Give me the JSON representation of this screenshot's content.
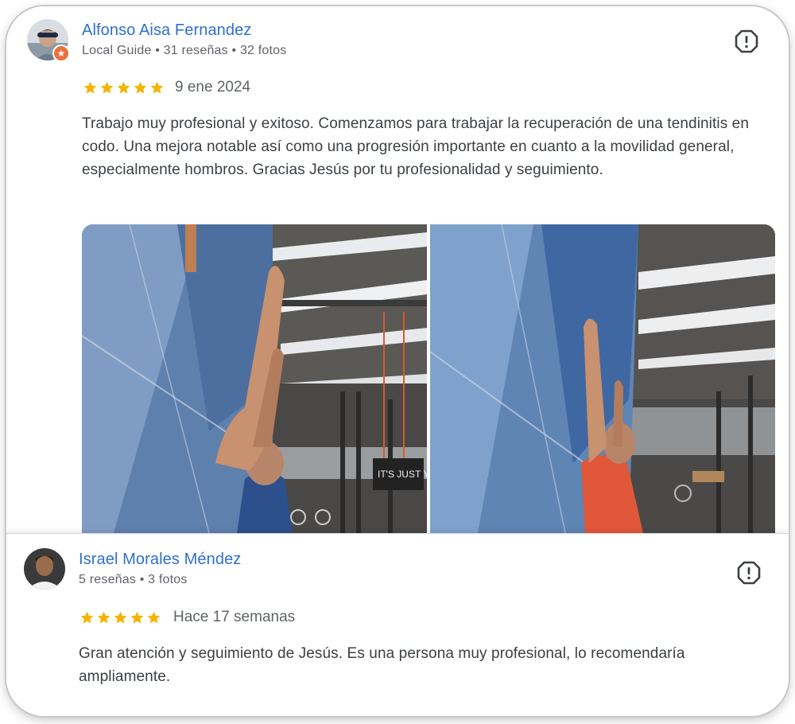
{
  "reviews": [
    {
      "author": "Alfonso Aisa Fernandez",
      "meta": "Local Guide • 31 reseñas • 32 fotos",
      "rating": 5,
      "date": "9 ene 2024",
      "text": "Trabajo muy profesional y exitoso. Comenzamos para trabajar la recuperación de una tendinitis en codo. Una mejora notable así como una progresión importante en cuanto a la movilidad general, especialmente hombros. Gracias Jesús por tu profesionalidad y seguimiento.",
      "photo_sign_text": "IT'S JUST YO"
    },
    {
      "author": "Israel Morales Méndez",
      "meta": "5 reseñas • 3 fotos",
      "rating": 5,
      "date": "Hace 17 semanas",
      "text": "Gran atención y seguimiento de Jesús. Es una persona muy profesional, lo recomendaría ampliamente."
    }
  ],
  "icons": {
    "star": "star-icon",
    "report": "report-flag-icon",
    "local_guide_badge": "local-guide-badge-icon"
  },
  "colors": {
    "author_link": "#2f6fd0",
    "star": "#f4b400",
    "meta_text": "#5f6368",
    "body_text": "#3c4043"
  }
}
